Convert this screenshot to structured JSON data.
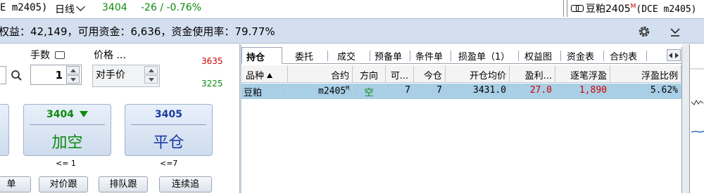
{
  "top_bar": {
    "contract_code": "E m2405)",
    "period": "日线",
    "last_price": "3404",
    "change": "-26 / -0.76%",
    "right_title_name": "豆粕2405",
    "right_title_sup": "M",
    "right_title_exchange": "(DCE m2405)"
  },
  "account": {
    "summary": "权益：42,149，可用资金：6,636，资金使用率：79.77%",
    "settings_icon": "gear-icon",
    "collapse_icon": "chevron-down-icon"
  },
  "order": {
    "qty_label": "手数",
    "qty_value": "1",
    "price_label": "价格 ...",
    "price_value": "对手价",
    "limit_up": "3635",
    "limit_down": "3225",
    "add_short_price": "3404",
    "add_short_label": "加空",
    "add_short_note": "<= 1",
    "close_price": "3405",
    "close_label": "平仓",
    "close_note": "<=7",
    "buttons": [
      "单",
      "对价跟",
      "排队跟",
      "连续追"
    ]
  },
  "tabs": [
    "持仓",
    "委托",
    "成交",
    "预备单",
    "条件单",
    "损盈单（1）",
    "权益图",
    "资金表",
    "合约表"
  ],
  "positions": {
    "columns": [
      "品种",
      "合约",
      "方向",
      "可...",
      "今仓",
      "开仓均价",
      "盈利...",
      "逐笔浮盈",
      "浮盈比例"
    ],
    "rows": [
      {
        "product": "豆粕",
        "contract": "m2405",
        "contract_sup": "M",
        "direction": "空",
        "available": "7",
        "today": "7",
        "avg_price": "3431.0",
        "profit": "27.0",
        "float_pnl": "1,890",
        "float_ratio": "5.62%"
      }
    ]
  },
  "colors": {
    "accent_bar": "#d3dfef",
    "up_red": "#d00000",
    "down_green": "#0a8a0a",
    "close_blue": "#1a3aa0",
    "row_selected": "#a8cfe6"
  }
}
